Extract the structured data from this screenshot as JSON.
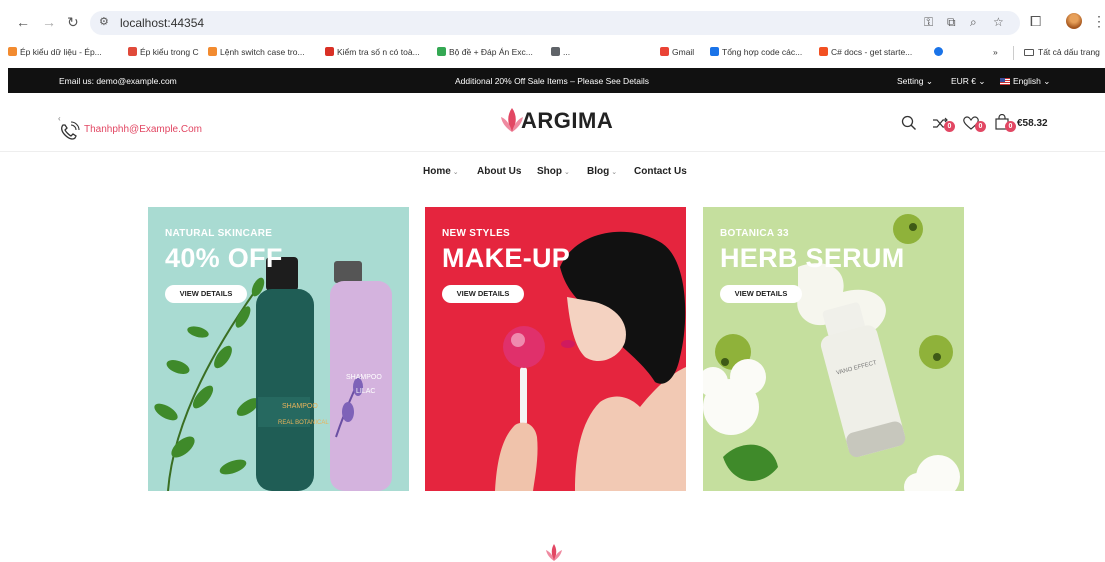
{
  "browser": {
    "url": "localhost:44354",
    "bookmarks": [
      {
        "label": "Ép kiểu dữ liệu - Ép...",
        "color": "#f28b30"
      },
      {
        "label": "Ép kiểu trong C",
        "color": "#e04a3a"
      },
      {
        "label": "Lệnh switch case tro...",
        "color": "#f28b30"
      },
      {
        "label": "Kiểm tra số n có toà...",
        "color": "#d93025"
      },
      {
        "label": "Bộ đề + Đáp Án Exc...",
        "color": "#34a853"
      },
      {
        "label": "...",
        "color": "#5f6368"
      },
      {
        "label": "Gmail",
        "color": "#ea4335"
      },
      {
        "label": "Tổng hợp code các...",
        "color": "#1a73e8"
      },
      {
        "label": "C# docs - get starte...",
        "color": "#f25022"
      }
    ],
    "more_bookmarks": "»",
    "all_bookmarks": "Tất cả dấu trang"
  },
  "topbar": {
    "email": "Email us: demo@example.com",
    "sale": "Additional 20% Off Sale Items – Please See Details",
    "setting": "Setting",
    "currency": "EUR €",
    "language": "English"
  },
  "header": {
    "email": "Thanhphh@Example.Com",
    "logo": "ARGIMA",
    "compare_count": "0",
    "wishlist_count": "0",
    "cart_count": "0",
    "cart_total": "€58.32"
  },
  "nav": {
    "items": [
      {
        "label": "Home",
        "dropdown": true
      },
      {
        "label": "About Us",
        "dropdown": false
      },
      {
        "label": "Shop",
        "dropdown": true
      },
      {
        "label": "Blog",
        "dropdown": true
      },
      {
        "label": "Contact Us",
        "dropdown": false
      }
    ]
  },
  "banners": [
    {
      "kicker": "NATURAL SKINCARE",
      "title": "40% OFF",
      "button": "VIEW DETAILS",
      "bg": "#a9dbd2"
    },
    {
      "kicker": "NEW STYLES",
      "title": "MAKE-UP",
      "button": "VIEW DETAILS",
      "bg": "#e5253e"
    },
    {
      "kicker": "BOTANICA 33",
      "title": "HERB SERUM",
      "button": "VIEW DETAILS",
      "bg": "#c5df9e"
    }
  ],
  "product_text": {
    "bottle1": "SHAMPOO",
    "bottle1_sub": "REAL BOTANICAL",
    "bottle2": "SHAMPOO",
    "bottle2_sub": "LILAC",
    "serum": "VANO EFFECT"
  },
  "colors": {
    "accent": "#e24763",
    "topbar": "#111111"
  }
}
